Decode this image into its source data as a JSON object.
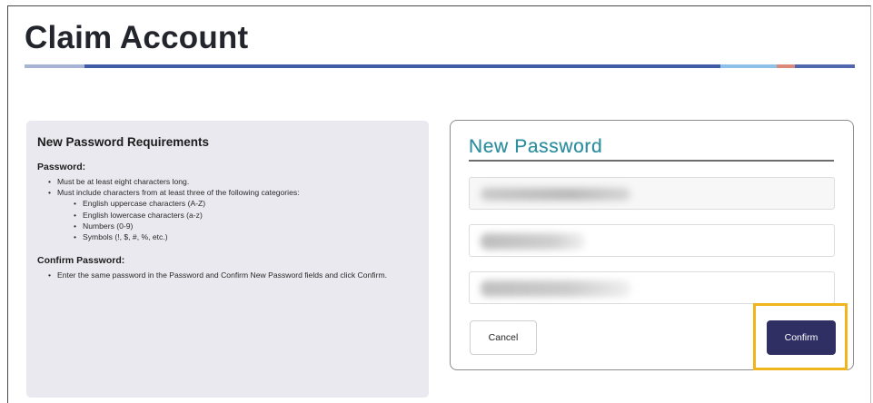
{
  "page": {
    "title": "Claim Account"
  },
  "requirements": {
    "heading": "New Password Requirements",
    "password_label": "Password:",
    "password_rules": [
      "Must be at least eight characters long.",
      "Must include characters from at least three of the following categories:"
    ],
    "categories": [
      "English uppercase characters (A-Z)",
      "English lowercase characters (a-z)",
      "Numbers (0-9)",
      "Symbols (!, $, #, %, etc.)"
    ],
    "confirm_label": "Confirm Password:",
    "confirm_rules": [
      "Enter the same password in the Password and Confirm New Password fields and click Confirm."
    ]
  },
  "form": {
    "title": "New Password",
    "cancel_label": "Cancel",
    "confirm_label": "Confirm"
  },
  "colors": {
    "title_rule_primary": "#3f5aa6",
    "form_title": "#2f8f9f",
    "confirm_button": "#2f2f63",
    "highlight": "#f0b41c"
  }
}
